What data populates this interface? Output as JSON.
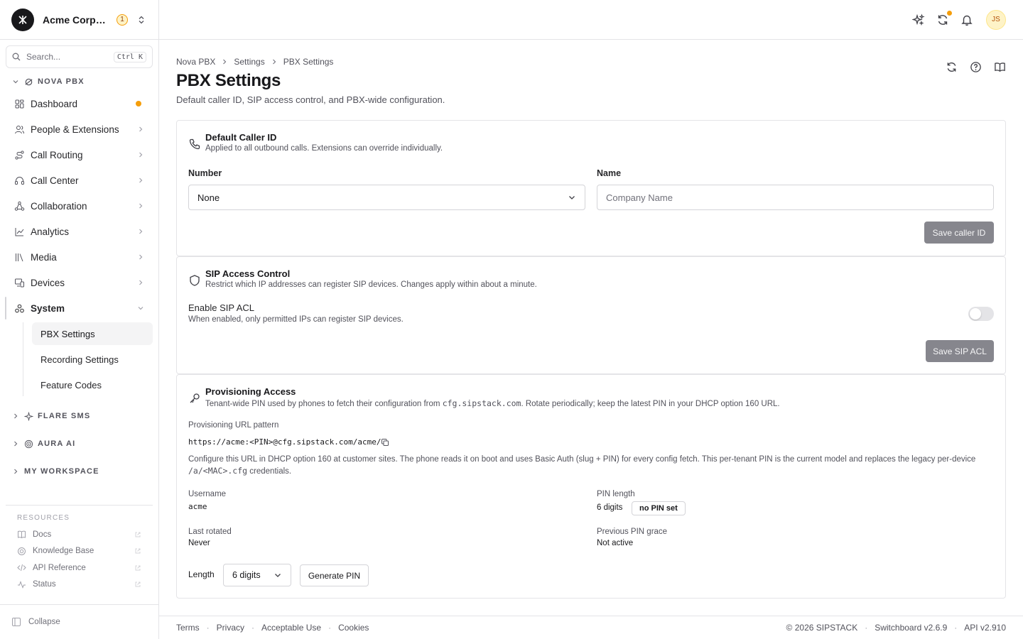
{
  "org": {
    "name": "Acme Corporation",
    "badge": "1"
  },
  "search": {
    "placeholder": "Search...",
    "shortcut": "Ctrl K"
  },
  "sidebar": {
    "section_nova": "NOVA PBX",
    "items": [
      {
        "label": "Dashboard",
        "icon": "dashboard-icon"
      },
      {
        "label": "People & Extensions",
        "icon": "people-icon"
      },
      {
        "label": "Call Routing",
        "icon": "routing-icon"
      },
      {
        "label": "Call Center",
        "icon": "headset-icon"
      },
      {
        "label": "Collaboration",
        "icon": "collaboration-icon"
      },
      {
        "label": "Analytics",
        "icon": "chart-icon"
      },
      {
        "label": "Media",
        "icon": "media-library-icon"
      },
      {
        "label": "Devices",
        "icon": "devices-icon"
      },
      {
        "label": "System",
        "icon": "system-icon"
      }
    ],
    "system_sub": [
      "PBX Settings",
      "Recording Settings",
      "Feature Codes"
    ],
    "collapsed_sections": [
      "FLARE SMS",
      "AURA AI",
      "MY WORKSPACE"
    ],
    "resources_label": "RESOURCES",
    "resources": [
      "Docs",
      "Knowledge Base",
      "API Reference",
      "Status"
    ],
    "collapse_label": "Collapse"
  },
  "header": {
    "avatar_initials": "JS"
  },
  "breadcrumb": [
    "Nova PBX",
    "Settings",
    "PBX Settings"
  ],
  "page": {
    "title": "PBX Settings",
    "subtitle": "Default caller ID, SIP access control, and PBX-wide configuration."
  },
  "caller_id": {
    "title": "Default Caller ID",
    "desc": "Applied to all outbound calls. Extensions can override individually.",
    "number_label": "Number",
    "number_value": "None",
    "name_label": "Name",
    "name_placeholder": "Company Name",
    "save_label": "Save caller ID"
  },
  "sip_acl": {
    "title": "SIP Access Control",
    "desc": "Restrict which IP addresses can register SIP devices. Changes apply within about a minute.",
    "toggle_label": "Enable SIP ACL",
    "toggle_desc": "When enabled, only permitted IPs can register SIP devices.",
    "enabled": false,
    "save_label": "Save SIP ACL"
  },
  "provisioning": {
    "title": "Provisioning Access",
    "desc_pre": "Tenant-wide PIN used by phones to fetch their configuration from ",
    "desc_host": "cfg.sipstack.com",
    "desc_post": ". Rotate periodically; keep the latest PIN in your DHCP option 160 URL.",
    "url_label": "Provisioning URL pattern",
    "url_value": "https://acme:<PIN>@cfg.sipstack.com/acme/",
    "help_pre": "Configure this URL in DHCP option 160 at customer sites. The phone reads it on boot and uses Basic Auth (slug + PIN) for every config fetch. This per-tenant PIN is the current model and replaces the legacy per-device ",
    "help_code": "/a/<MAC>.cfg",
    "help_post": " credentials.",
    "username_label": "Username",
    "username_value": "acme",
    "pin_length_label": "PIN length",
    "pin_length_value": "6 digits",
    "pin_status": "no PIN set",
    "last_rotated_label": "Last rotated",
    "last_rotated_value": "Never",
    "grace_label": "Previous PIN grace",
    "grace_value": "Not active",
    "length_label": "Length",
    "length_value": "6 digits",
    "generate_label": "Generate PIN"
  },
  "footer": {
    "links": [
      "Terms",
      "Privacy",
      "Acceptable Use",
      "Cookies"
    ],
    "copyright": "© 2026 SIPSTACK",
    "switchboard": "Switchboard v2.6.9",
    "api": "API v2.910"
  },
  "colors": {
    "accent": "#f59e0b",
    "disabled_button": "#71717a",
    "border": "#e4e4e7"
  }
}
